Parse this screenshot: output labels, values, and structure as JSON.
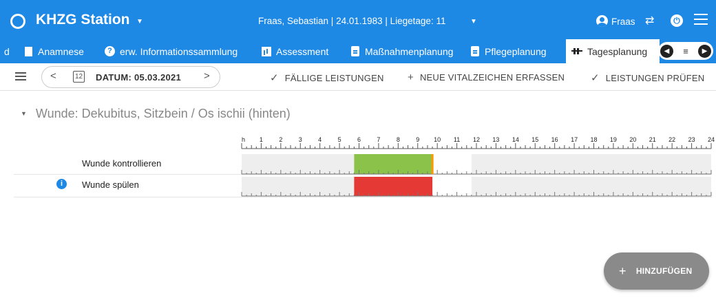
{
  "header": {
    "app_title": "KHZG Station",
    "patient_info": "Fraas, Sebastian | 24.01.1983 | Liegetage: 11",
    "user_name": "Fraas",
    "icons": [
      "logo-ring-icon",
      "chevron-down-icon",
      "account-icon",
      "swap-icon",
      "power-icon",
      "menu-icon"
    ]
  },
  "tabs": [
    {
      "label": "d",
      "icon": "none"
    },
    {
      "label": "Anamnese",
      "icon": "document-icon"
    },
    {
      "label": "erw. Informationssammlung",
      "icon": "help-circle-icon"
    },
    {
      "label": "Assessment",
      "icon": "chart-icon"
    },
    {
      "label": "Maßnahmenplanung",
      "icon": "clipboard-icon"
    },
    {
      "label": "Pflegeplanung",
      "icon": "clipboard-icon"
    },
    {
      "label": "Tagesplanung",
      "icon": "schedule-icon",
      "active": true
    }
  ],
  "toolbar": {
    "date_label": "DATUM:  05.03.2021",
    "calendar_day": "12",
    "due_services": "FÄLLIGE LEISTUNGEN",
    "new_vitals": "NEUE VITALZEICHEN ERFASSEN",
    "check_services": "LEISTUNGEN PRÜFEN"
  },
  "section": {
    "title": "Wunde: Dekubitus, Sitzbein / Os ischii (hinten)"
  },
  "timeline": {
    "hour_labels": [
      "h",
      "1",
      "2",
      "3",
      "4",
      "5",
      "6",
      "7",
      "8",
      "9",
      "10",
      "11",
      "12",
      "13",
      "14",
      "15",
      "16",
      "17",
      "18",
      "19",
      "20",
      "21",
      "22",
      "23",
      "24"
    ],
    "available_ranges": [
      [
        0,
        9.75
      ],
      [
        11.75,
        24
      ]
    ],
    "current_hour": 9.7,
    "tasks": [
      {
        "label": "Wunde kontrollieren",
        "info": false,
        "status": "done",
        "start_hour": 5.75,
        "end_hour": 9.75,
        "color": "#8bc34a"
      },
      {
        "label": "Wunde spülen",
        "info": true,
        "status": "overdue",
        "start_hour": 5.75,
        "end_hour": 9.75,
        "color": "#e53935"
      }
    ],
    "marker_color": "#ff9800",
    "available_color": "#eeeeee"
  },
  "fab": {
    "label": "HINZUFÜGEN"
  },
  "colors": {
    "primary": "#1e88e5",
    "fab": "#8a8a8a"
  }
}
